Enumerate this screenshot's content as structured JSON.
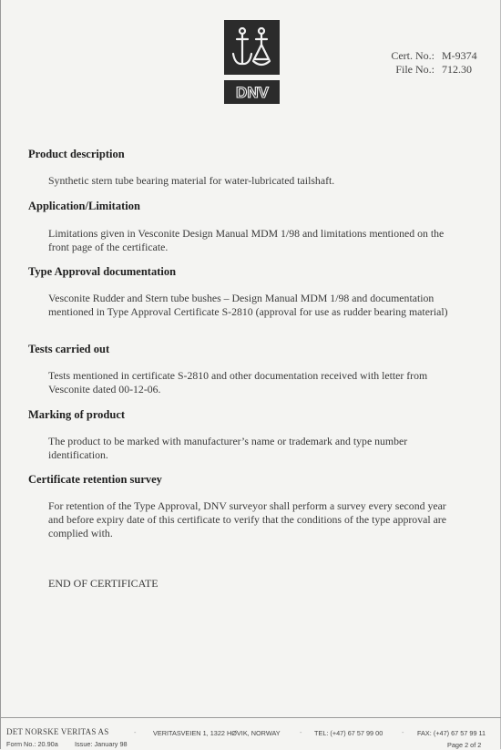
{
  "header": {
    "logo_text": "DNV",
    "cert_label": "Cert. No.:",
    "cert_value": "M-9374",
    "file_label": "File No.:",
    "file_value": "712.30"
  },
  "sections": [
    {
      "heading": "Product description",
      "text": "Synthetic stern tube bearing material for water-lubricated tailshaft."
    },
    {
      "heading": "Application/Limitation",
      "text": "Limitations given in Vesconite Design Manual MDM 1/98 and limitations mentioned on the front page of the certificate."
    },
    {
      "heading": "Type Approval documentation",
      "text": "Vesconite Rudder and Stern tube bushes – Design Manual MDM 1/98 and documentation mentioned in Type Approval Certificate S-2810 (approval for use as rudder bearing material)"
    },
    {
      "heading": "Tests carried out",
      "text": "Tests mentioned in certificate S-2810 and other documentation received with letter from Vesconite dated 00-12-06."
    },
    {
      "heading": "Marking of product",
      "text": "The product to be marked with manufacturer’s name or trademark and type number identification."
    },
    {
      "heading": "Certificate retention survey",
      "text": "For retention of the Type Approval, DNV surveyor shall perform a survey every second year and before expiry date of this certificate to verify that the conditions of the type approval are complied with."
    }
  ],
  "end_text": "END OF CERTIFICATE",
  "footer": {
    "company": "DET NORSKE VERITAS AS",
    "address": "VERITASVEIEN 1, 1322 HØVIK,   NORWAY",
    "tel": "TEL: (+47) 67 57 99 00",
    "fax": "FAX: (+47) 67 57 99 11",
    "form_no": "Form No.: 20.90a",
    "issue": "Issue: January 98",
    "page": "Page 2 of 2"
  }
}
